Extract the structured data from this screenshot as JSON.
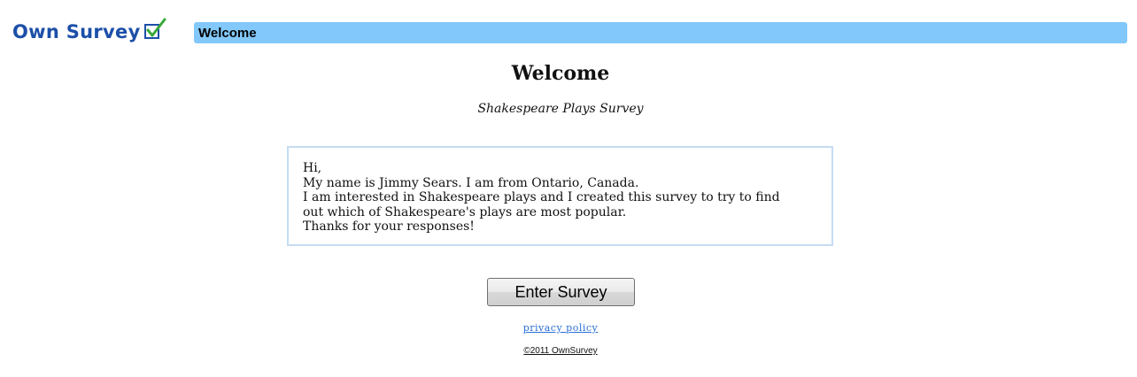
{
  "logo": {
    "text": "Own Survey",
    "icon": "checkmark-icon",
    "color": "#1c4fa8",
    "check_color": "#3aa83a"
  },
  "header": {
    "title": "Welcome",
    "bar_color": "#82c8fb"
  },
  "main": {
    "title": "Welcome",
    "subtitle": "Shakespeare Plays Survey",
    "message_lines": [
      "Hi,",
      "My name is Jimmy Sears. I am from Ontario, Canada.",
      "I am interested in Shakespeare plays and I created this survey to try to find",
      "out which of Shakespeare's plays are most popular.",
      "Thanks for your responses!"
    ],
    "enter_button": "Enter Survey"
  },
  "footer": {
    "privacy_link": "privacy policy",
    "copyright": "©2011 OwnSurvey",
    "link_color": "#2a6fd6"
  }
}
